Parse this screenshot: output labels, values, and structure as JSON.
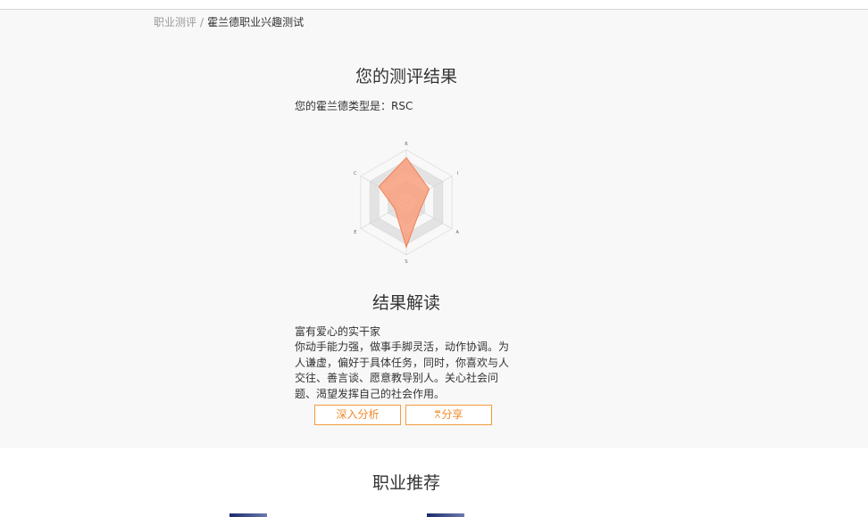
{
  "breadcrumb": {
    "parent": "职业测评",
    "separator": "/",
    "current": "霍兰德职业兴趣测试"
  },
  "result": {
    "title": "您的测评结果",
    "type_line": "您的霍兰德类型是：RSC"
  },
  "radar_chart": {
    "axes": [
      "R",
      "I",
      "A",
      "S",
      "E",
      "C"
    ],
    "values": [
      0.85,
      0.5,
      0.3,
      0.85,
      0.25,
      0.6
    ],
    "max": 1,
    "rings": 5,
    "fill_color": "#f9a07e",
    "stroke_color": "#f27f57"
  },
  "interpretation": {
    "title": "结果解读",
    "heading": "富有爱心的实干家",
    "body": "你动手能力强，做事手脚灵活，动作协调。为人谦虚，偏好于具体任务，同时，你喜欢与人交往、善言谈、愿意教导别人。关心社会问题、渴望发挥自己的社会作用。"
  },
  "actions": {
    "analyze_label": "深入分析",
    "share_icon": "share-icon",
    "share_label": "分享"
  },
  "recommendations": {
    "title": "职业推荐"
  },
  "colors": {
    "accent": "#f08a2b",
    "section_bg": "#f8f8f8"
  }
}
